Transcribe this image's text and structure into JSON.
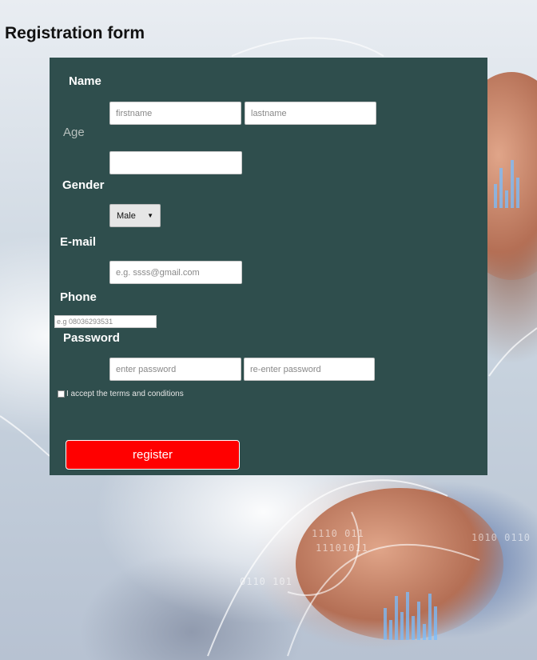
{
  "page": {
    "title": "Registration form"
  },
  "form": {
    "name_label": "Name",
    "firstname_placeholder": "firstname",
    "lastname_placeholder": "lastname",
    "age_label": "Age",
    "age_value": "",
    "gender_label": "Gender",
    "gender_selected": "Male",
    "email_label": "E-mail",
    "email_placeholder": "e.g. ssss@gmail.com",
    "phone_label": "Phone",
    "phone_placeholder": "e.g 08036293531",
    "password_label": "Password",
    "password_placeholder": "enter password",
    "password_confirm_placeholder": "re-enter password",
    "terms_label": "I accept the terms and conditions",
    "terms_checked": false,
    "register_label": "register"
  },
  "colors": {
    "panel": "#2f4e4d",
    "register_button": "#ff0000"
  },
  "background": {
    "code_fragments": [
      "1110 011",
      "11101011",
      "0110 101",
      "1010 0110"
    ]
  }
}
